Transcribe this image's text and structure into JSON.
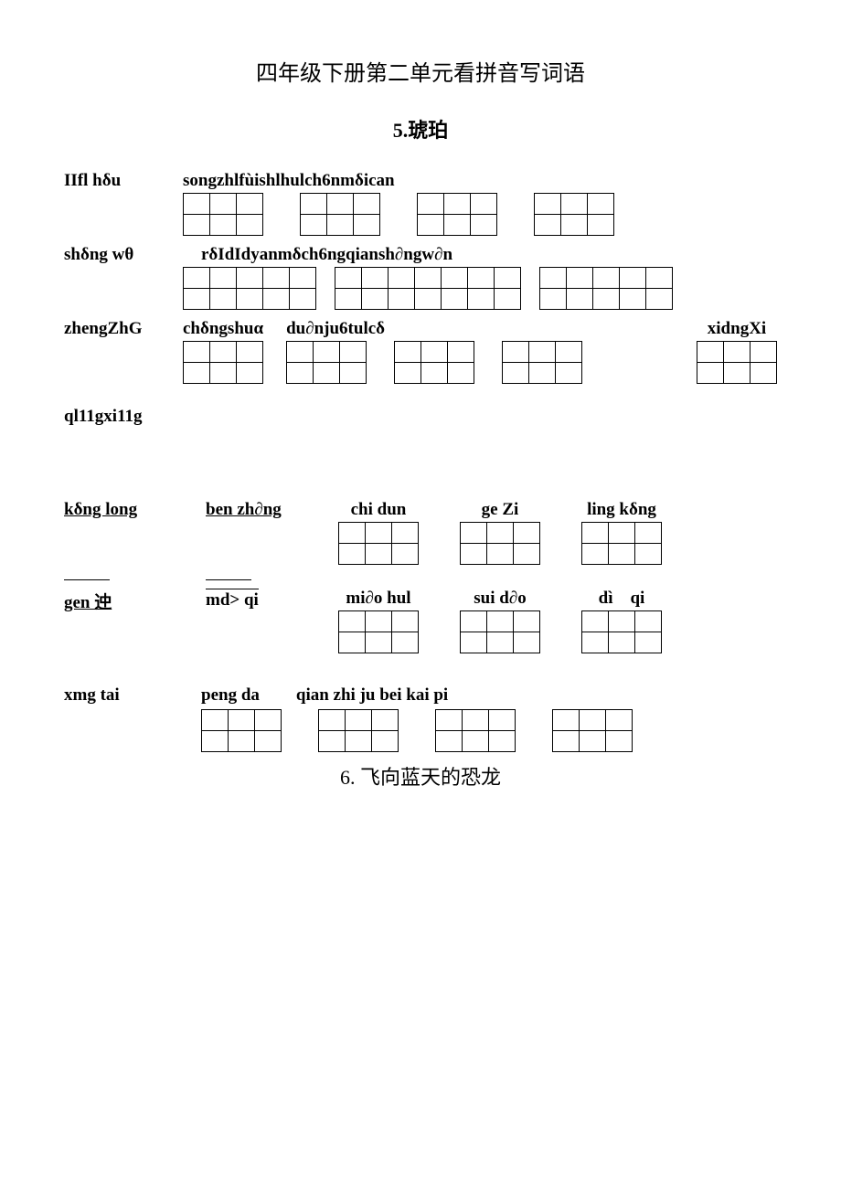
{
  "title": "四年级下册第二单元看拼音写词语",
  "sub1": "5.琥珀",
  "sub2": "6. 飞向蓝天的恐龙",
  "s1": {
    "r1_left": "IIfl hδu",
    "r1_label": "songzhlfùishlhulch6nmδican",
    "r2_left": "shδng wθ",
    "r2_label": "rδIdIdyanmδch6ngqiansh∂ngw∂n",
    "r3_left": "zhengZhG",
    "r3_a": "chδngshuα",
    "r3_b": "du∂nju6tulcδ",
    "r3_c": "xidngXi",
    "r4_left": "ql11gxi11g"
  },
  "s2": {
    "r1": [
      "kδng long",
      "ben zh∂ng",
      "chi dun",
      "ge Zi",
      "ling kδng"
    ],
    "r2": [
      "gen 迚",
      "md> qi",
      "mi∂o hul",
      "sui d∂o",
      "dì    qi"
    ],
    "r3_left": "xmg tai",
    "r3_a": "peng da",
    "r3_b": "qian zhi ju bei kai pi"
  }
}
